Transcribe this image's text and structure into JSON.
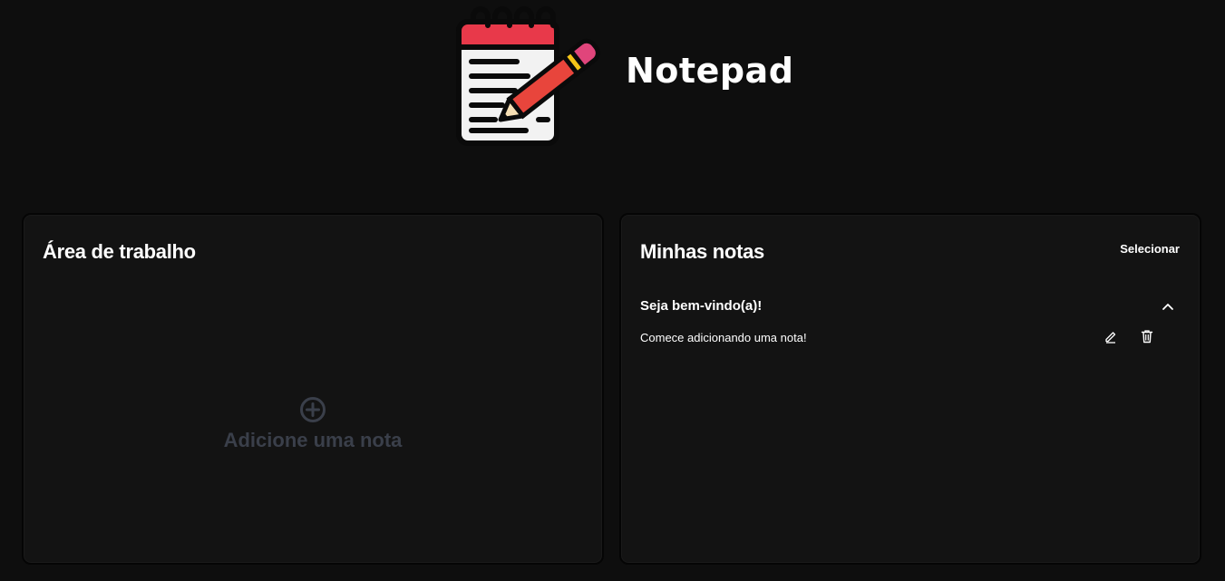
{
  "header": {
    "app_title": "Notepad",
    "logo_icon": "notepad-pencil-logo"
  },
  "workspace": {
    "title": "Área de trabalho",
    "add_note_label": "Adicione uma nota",
    "add_note_icon": "plus-circle-icon"
  },
  "notes": {
    "title": "Minhas notas",
    "select_label": "Selecionar",
    "items": [
      {
        "title": "Seja bem-vindo(a)!",
        "body": "Comece adicionando uma nota!",
        "expanded": true
      }
    ]
  },
  "colors": {
    "background": "#0e0e0e",
    "panel": "#131313",
    "muted_text": "#3a3f4a",
    "logo_red": "#e8394a",
    "pencil_red": "#e8453c",
    "eraser_pink": "#e0457b",
    "band_yellow": "#f5c518"
  }
}
